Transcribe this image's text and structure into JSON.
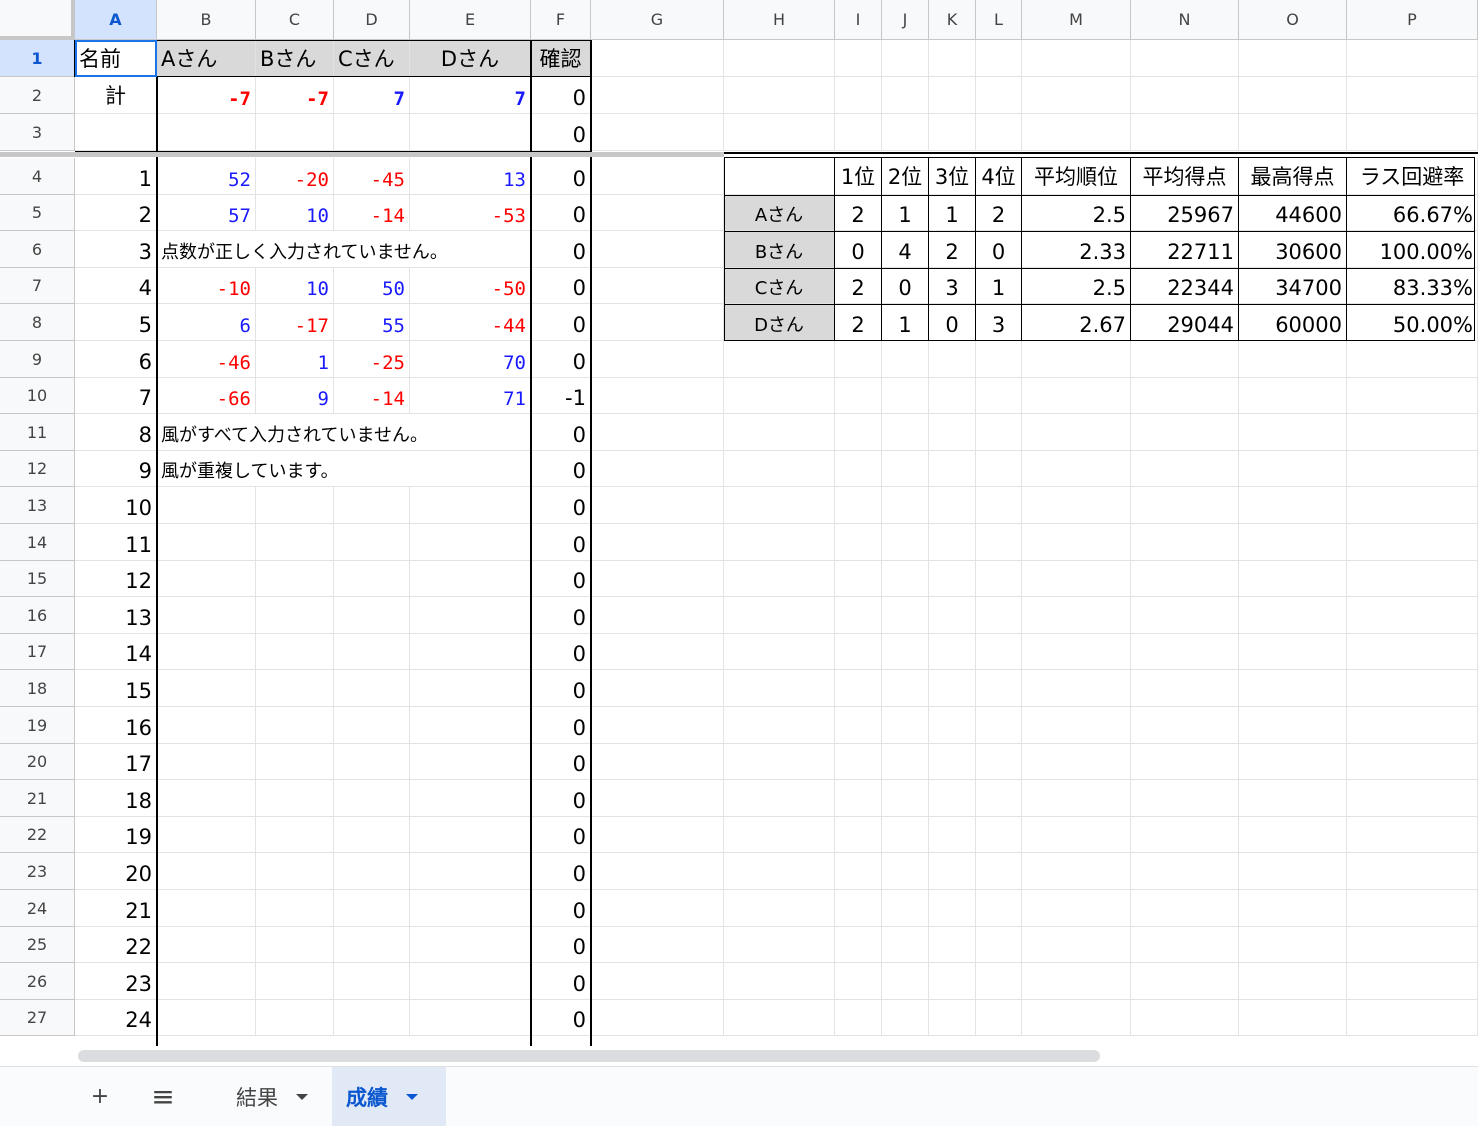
{
  "columns": [
    "A",
    "B",
    "C",
    "D",
    "E",
    "F",
    "G",
    "H",
    "I",
    "J",
    "K",
    "L",
    "M",
    "N",
    "O",
    "P"
  ],
  "rows": [
    "1",
    "2",
    "3",
    "4",
    "5",
    "6",
    "7",
    "8",
    "9",
    "10",
    "11",
    "12",
    "13",
    "14",
    "15",
    "16",
    "17",
    "18",
    "19",
    "20",
    "21",
    "22",
    "23",
    "24",
    "25",
    "26",
    "27"
  ],
  "header_row": {
    "name_label": "名前",
    "players": [
      "Aさん",
      "Bさん",
      "Cさん",
      "Dさん"
    ],
    "check_label": "確認"
  },
  "total_row": {
    "label": "計",
    "values": [
      "-7",
      "-7",
      "7",
      "7"
    ],
    "check": "0"
  },
  "row3": {
    "check": "0"
  },
  "games": [
    {
      "n": "1",
      "scores": [
        "52",
        "-20",
        "-45",
        "13"
      ],
      "msg": "",
      "check": "0"
    },
    {
      "n": "2",
      "scores": [
        "57",
        "10",
        "-14",
        "-53"
      ],
      "msg": "",
      "check": "0"
    },
    {
      "n": "3",
      "scores": [
        "",
        "",
        "",
        ""
      ],
      "msg": "点数が正しく入力されていません。",
      "check": "0"
    },
    {
      "n": "4",
      "scores": [
        "-10",
        "10",
        "50",
        "-50"
      ],
      "msg": "",
      "check": "0"
    },
    {
      "n": "5",
      "scores": [
        "6",
        "-17",
        "55",
        "-44"
      ],
      "msg": "",
      "check": "0"
    },
    {
      "n": "6",
      "scores": [
        "-46",
        "1",
        "-25",
        "70"
      ],
      "msg": "",
      "check": "0"
    },
    {
      "n": "7",
      "scores": [
        "-66",
        "9",
        "-14",
        "71"
      ],
      "msg": "",
      "check": "-1"
    },
    {
      "n": "8",
      "scores": [
        "",
        "",
        "",
        ""
      ],
      "msg": "風がすべて入力されていません。",
      "check": "0"
    },
    {
      "n": "9",
      "scores": [
        "",
        "",
        "",
        ""
      ],
      "msg": "風が重複しています。",
      "check": "0"
    },
    {
      "n": "10",
      "scores": [
        "",
        "",
        "",
        ""
      ],
      "msg": "",
      "check": "0"
    },
    {
      "n": "11",
      "scores": [
        "",
        "",
        "",
        ""
      ],
      "msg": "",
      "check": "0"
    },
    {
      "n": "12",
      "scores": [
        "",
        "",
        "",
        ""
      ],
      "msg": "",
      "check": "0"
    },
    {
      "n": "13",
      "scores": [
        "",
        "",
        "",
        ""
      ],
      "msg": "",
      "check": "0"
    },
    {
      "n": "14",
      "scores": [
        "",
        "",
        "",
        ""
      ],
      "msg": "",
      "check": "0"
    },
    {
      "n": "15",
      "scores": [
        "",
        "",
        "",
        ""
      ],
      "msg": "",
      "check": "0"
    },
    {
      "n": "16",
      "scores": [
        "",
        "",
        "",
        ""
      ],
      "msg": "",
      "check": "0"
    },
    {
      "n": "17",
      "scores": [
        "",
        "",
        "",
        ""
      ],
      "msg": "",
      "check": "0"
    },
    {
      "n": "18",
      "scores": [
        "",
        "",
        "",
        ""
      ],
      "msg": "",
      "check": "0"
    },
    {
      "n": "19",
      "scores": [
        "",
        "",
        "",
        ""
      ],
      "msg": "",
      "check": "0"
    },
    {
      "n": "20",
      "scores": [
        "",
        "",
        "",
        ""
      ],
      "msg": "",
      "check": "0"
    },
    {
      "n": "21",
      "scores": [
        "",
        "",
        "",
        ""
      ],
      "msg": "",
      "check": "0"
    },
    {
      "n": "22",
      "scores": [
        "",
        "",
        "",
        ""
      ],
      "msg": "",
      "check": "0"
    },
    {
      "n": "23",
      "scores": [
        "",
        "",
        "",
        ""
      ],
      "msg": "",
      "check": "0"
    },
    {
      "n": "24",
      "scores": [
        "",
        "",
        "",
        ""
      ],
      "msg": "",
      "check": "0"
    }
  ],
  "stats": {
    "headers": [
      "1位",
      "2位",
      "3位",
      "4位",
      "平均順位",
      "平均得点",
      "最高得点",
      "ラス回避率"
    ],
    "rows": [
      {
        "name": "Aさん",
        "values": [
          "2",
          "1",
          "1",
          "2",
          "2.5",
          "25967",
          "44600",
          "66.67%"
        ]
      },
      {
        "name": "Bさん",
        "values": [
          "0",
          "4",
          "2",
          "0",
          "2.33",
          "22711",
          "30600",
          "100.00%"
        ]
      },
      {
        "name": "Cさん",
        "values": [
          "2",
          "0",
          "3",
          "1",
          "2.5",
          "22344",
          "34700",
          "83.33%"
        ]
      },
      {
        "name": "Dさん",
        "values": [
          "2",
          "1",
          "0",
          "3",
          "2.67",
          "29044",
          "60000",
          "50.00%"
        ]
      }
    ]
  },
  "tabbar": {
    "add_icon": "+",
    "menu_icon": "≡",
    "tabs": [
      {
        "label": "結果",
        "active": false
      },
      {
        "label": "成績",
        "active": true
      }
    ]
  },
  "colors": {
    "negative": "#ff0000",
    "positive": "#1a1aff",
    "selection": "#1a73e8",
    "active_tab": "#0b57d0"
  }
}
